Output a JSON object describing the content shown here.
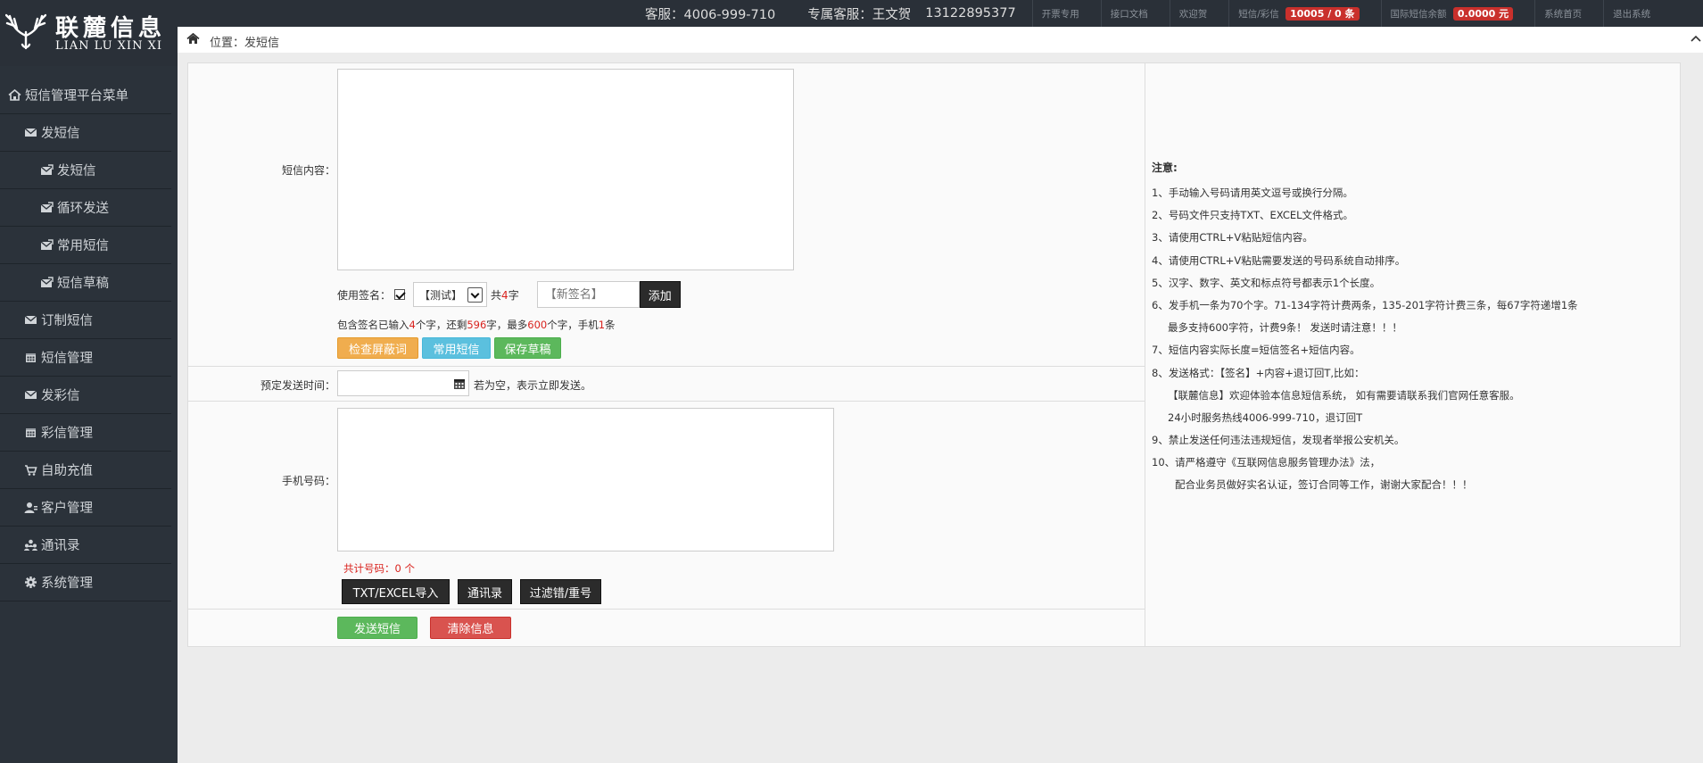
{
  "brand": {
    "name_cn": "联麓信息",
    "name_en": "LIAN LU XIN XI"
  },
  "topbar": {
    "service": "客服：4006-999-710",
    "exclusive": "专属客服：王文贺",
    "exclusive_phone": "13122895377",
    "links": [
      "开票专用",
      "接口文档",
      "欢迎贺"
    ],
    "sms_label": "短信/彩信",
    "sms_badge": "10005 / 0 条",
    "intl_label": "国际短信余额",
    "intl_badge": "0.0000 元",
    "home": "系统首页",
    "logout": "退出系统"
  },
  "sidebar": {
    "items": [
      {
        "label": "短信管理平台菜单",
        "icon": "home-icon"
      },
      {
        "label": "发短信",
        "icon": "envelope-icon"
      },
      {
        "label": "发短信",
        "icon": "envelope-send-icon"
      },
      {
        "label": "循环发送",
        "icon": "envelope-send-icon"
      },
      {
        "label": "常用短信",
        "icon": "envelope-send-icon"
      },
      {
        "label": "短信草稿",
        "icon": "envelope-send-icon"
      },
      {
        "label": "订制短信",
        "icon": "envelope-icon"
      },
      {
        "label": "短信管理",
        "icon": "calendar-icon"
      },
      {
        "label": "发彩信",
        "icon": "envelope-icon"
      },
      {
        "label": "彩信管理",
        "icon": "calendar-icon"
      },
      {
        "label": "自助充值",
        "icon": "cart-icon"
      },
      {
        "label": "客户管理",
        "icon": "user-icon"
      },
      {
        "label": "通讯录",
        "icon": "users-icon"
      },
      {
        "label": "系统管理",
        "icon": "gear-icon"
      }
    ]
  },
  "breadcrumb": {
    "label": "位置：",
    "current": "发短信"
  },
  "form": {
    "content_label": "短信内容：",
    "signature_label": "使用签名：",
    "signature_selected": "【测试】",
    "sig_count_pre": "共",
    "sig_count": "4",
    "sig_count_post": "字",
    "new_signature_placeholder": "【新签名】",
    "add_button": "添加",
    "count": {
      "p1": "包含签名已输入",
      "typed": "4",
      "p2": "个字，还剩",
      "remaining": "596",
      "p3": "字，最多",
      "max": "600",
      "p4": "个字，手机",
      "segments": "1",
      "p5": "条"
    },
    "check_words_button": "检查屏蔽词",
    "common_sms_button": "常用短信",
    "save_draft_button": "保存草稿",
    "schedule_label": "预定发送时间：",
    "schedule_value": "",
    "schedule_hint": "若为空，表示立即发送。",
    "phone_label": "手机号码：",
    "total_numbers": "共计号码：0 个",
    "import_button": "TXT/EXCEL导入",
    "contacts_button": "通讯录",
    "filter_button": "过滤错/重号",
    "send_button": "发送短信",
    "clear_button": "清除信息"
  },
  "notes": {
    "title": "注意:",
    "lines": [
      "1、手动输入号码请用英文逗号或换行分隔。",
      "2、号码文件只支持TXT、EXCEL文件格式。",
      "3、请使用CTRL+V粘贴短信内容。",
      "4、请使用CTRL+V粘贴需要发送的号码系统自动排序。",
      "5、汉字、数字、英文和标点符号都表示1个长度。",
      "6、发手机一条为70个字。71-134字符计费两条，135-201字符计费三条，每67字符递增1条",
      "最多支持600字符，计费9条！ 发送时请注意！！！",
      "7、短信内容实际长度=短信签名+短信内容。",
      "8、发送格式：【签名】+内容+退订回T,比如：",
      "【联麓信息】欢迎体验本信息短信系统， 如有需要请联系我们官网任意客服。",
      "24小时服务热线4006-999-710，退订回T",
      "9、禁止发送任何违法违规短信，发现者举报公安机关。",
      "10、请严格遵守《互联网信息服务管理办法》法，",
      "配合业务员做好实名认证，签订合同等工作，谢谢大家配合！！！"
    ]
  }
}
